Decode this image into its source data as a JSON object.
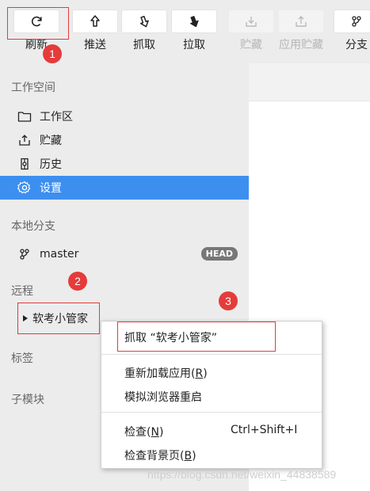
{
  "toolbar": {
    "buttons": [
      {
        "label": "刷新",
        "icon": "refresh-icon",
        "enabled": true
      },
      {
        "label": "推送",
        "icon": "push-icon",
        "enabled": true
      },
      {
        "label": "抓取",
        "icon": "fetch-icon",
        "enabled": true
      },
      {
        "label": "拉取",
        "icon": "pull-icon",
        "enabled": true
      },
      {
        "label": "贮藏",
        "icon": "stash-icon",
        "enabled": false
      },
      {
        "label": "应用贮藏",
        "icon": "apply-stash-icon",
        "enabled": false
      },
      {
        "label": "分支",
        "icon": "branch-icon",
        "enabled": true
      }
    ]
  },
  "sidebar": {
    "workspace": {
      "title": "工作空间",
      "items": [
        {
          "label": "工作区",
          "icon": "folder-icon"
        },
        {
          "label": "贮藏",
          "icon": "stash-icon"
        },
        {
          "label": "历史",
          "icon": "history-icon"
        },
        {
          "label": "设置",
          "icon": "gear-icon",
          "active": true
        }
      ]
    },
    "local_branches": {
      "title": "本地分支",
      "items": [
        {
          "label": "master",
          "badge": "HEAD",
          "icon": "branch-icon"
        }
      ]
    },
    "remotes": {
      "title": "远程",
      "items": [
        {
          "label": "软考小管家"
        }
      ]
    },
    "tags": {
      "title": "标签"
    },
    "submodules": {
      "title": "子模块"
    }
  },
  "context_menu": {
    "items": [
      {
        "label": "抓取 “软考小管家”"
      },
      {
        "label": "重新加载应用(R)",
        "text": "重新加载应用(",
        "key": "R",
        "end": ")"
      },
      {
        "label": "模拟浏览器重启"
      },
      {
        "label": "检查(N)",
        "text": "检查(",
        "key": "N",
        "end": ")",
        "accel": "Ctrl+Shift+I"
      },
      {
        "label": "检查背景页(B)",
        "text": "检查背景页(",
        "key": "B",
        "end": ")"
      }
    ]
  },
  "markers": [
    "1",
    "2",
    "3"
  ],
  "watermark": "https://blog.csdn.net/weixin_44838589",
  "colors": {
    "accent": "#3d8fef",
    "annotation": "#e13c3c",
    "sidebar_bg": "#ececec"
  }
}
